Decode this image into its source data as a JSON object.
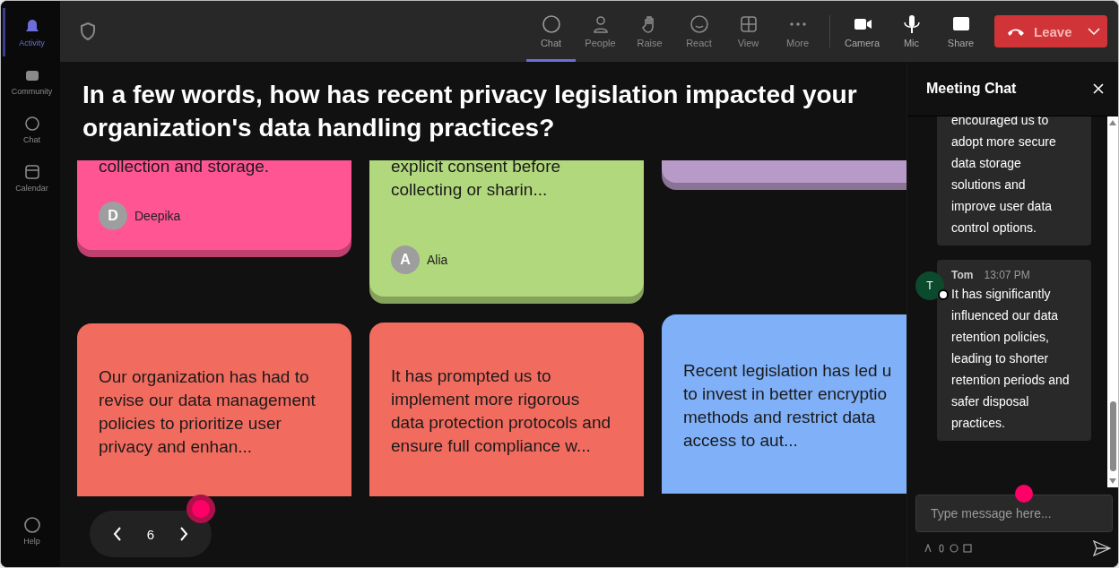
{
  "rail": {
    "items": [
      {
        "label": "Activity",
        "selected": true
      },
      {
        "label": "Community",
        "selected": false
      },
      {
        "label": "Chat",
        "selected": false
      },
      {
        "label": "Calendar",
        "selected": false
      }
    ],
    "help": "Help"
  },
  "toolbar": {
    "items": [
      {
        "label": "Chat",
        "selected": true
      },
      {
        "label": "People",
        "selected": false
      },
      {
        "label": "Raise",
        "selected": false
      },
      {
        "label": "React",
        "selected": false
      },
      {
        "label": "View",
        "selected": false
      },
      {
        "label": "More",
        "selected": false
      }
    ],
    "media": [
      {
        "label": "Camera"
      },
      {
        "label": "Mic"
      },
      {
        "label": "Share"
      }
    ],
    "leave": "Leave"
  },
  "question": "In a few words, how has recent privacy legislation impacted your organization's data handling practices?",
  "columns": [
    {
      "cards": [
        {
          "lines": [
            "collection and storage."
          ],
          "author": "Deepika",
          "initial": "D",
          "color": "#ff5592"
        },
        {
          "lines": [
            "Our organization has had to",
            "revise our data management",
            "policies to prioritize user",
            "privacy and enhan..."
          ],
          "color": "#f26b5f"
        }
      ]
    },
    {
      "cards": [
        {
          "lines": [
            "explicit consent before",
            "collecting or sharin..."
          ],
          "author": "Alia",
          "initial": "A",
          "color": "#b1d87c"
        },
        {
          "lines": [
            "It has prompted us to",
            "implement more rigorous",
            "data protection protocols and",
            "ensure full compliance w..."
          ],
          "color": "#f26b5f"
        }
      ]
    },
    {
      "cards": [
        {
          "color": "#b89ac8"
        },
        {
          "lines": [
            "Recent legislation has led u",
            "to invest in better encryptio",
            "methods and restrict data",
            "access to aut..."
          ],
          "color": "#7fb0f8"
        }
      ]
    }
  ],
  "pager": {
    "page": "6"
  },
  "chat": {
    "title": "Meeting Chat",
    "messages": [
      {
        "lines": [
          "encouraged us to",
          "adopt more secure",
          "data storage",
          "solutions and",
          "improve user data",
          "control options."
        ]
      },
      {
        "sender": "Tom",
        "initial": "T",
        "time": "13:07 PM",
        "lines": [
          "It has significantly",
          "influenced our data",
          "retention policies,",
          "leading to shorter",
          "retention periods and",
          "safer disposal",
          "practices."
        ]
      }
    ],
    "placeholder": "Type message here..."
  }
}
